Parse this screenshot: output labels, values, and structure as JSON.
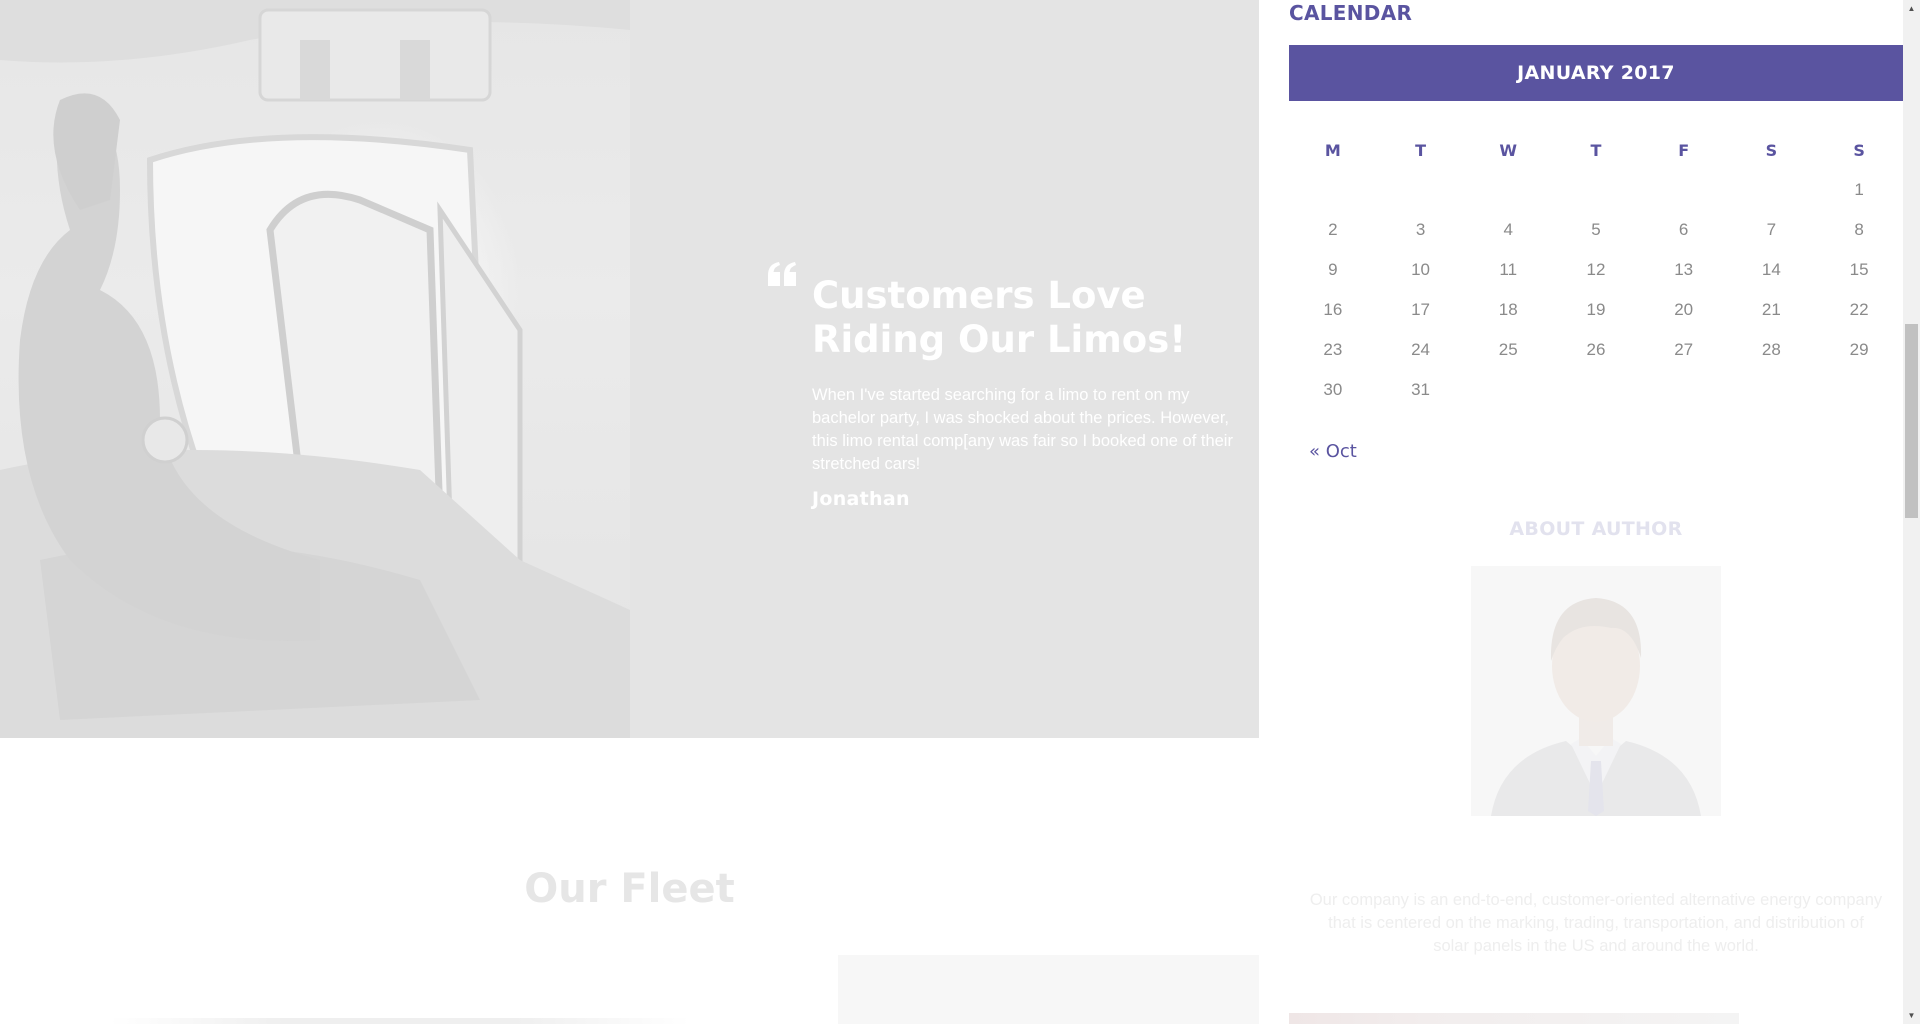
{
  "testimonial": {
    "quote_icon": "quote-left-icon",
    "title": "Customers Love Riding Our Limos!",
    "text": "When I've started searching for a limo to rent on my bachelor party, I was shocked about the prices. However, this limo rental comp[any was fair so I booked one of their stretched cars!",
    "author": "Jonathan"
  },
  "fleet": {
    "title": "Our Fleet"
  },
  "calendar": {
    "heading": "CALENDAR",
    "month": "JANUARY 2017",
    "weekdays": [
      "M",
      "T",
      "W",
      "T",
      "F",
      "S",
      "S"
    ],
    "weeks": [
      [
        "",
        "",
        "",
        "",
        "",
        "",
        "1"
      ],
      [
        "2",
        "3",
        "4",
        "5",
        "6",
        "7",
        "8"
      ],
      [
        "9",
        "10",
        "11",
        "12",
        "13",
        "14",
        "15"
      ],
      [
        "16",
        "17",
        "18",
        "19",
        "20",
        "21",
        "22"
      ],
      [
        "23",
        "24",
        "25",
        "26",
        "27",
        "28",
        "29"
      ],
      [
        "30",
        "31",
        "",
        "",
        "",
        "",
        ""
      ]
    ],
    "prev_link": "« Oct"
  },
  "about": {
    "heading": "ABOUT AUTHOR",
    "text": "Our company is an end-to-end, customer-oriented alternative energy company that is centered on the marking, trading, transportation, and distribution of solar panels in the US and around the world."
  },
  "colors": {
    "accent": "#5a54a0",
    "hero_overlay": "#e4e4e4"
  },
  "scrollbar": {
    "position_fraction": 0.32
  }
}
